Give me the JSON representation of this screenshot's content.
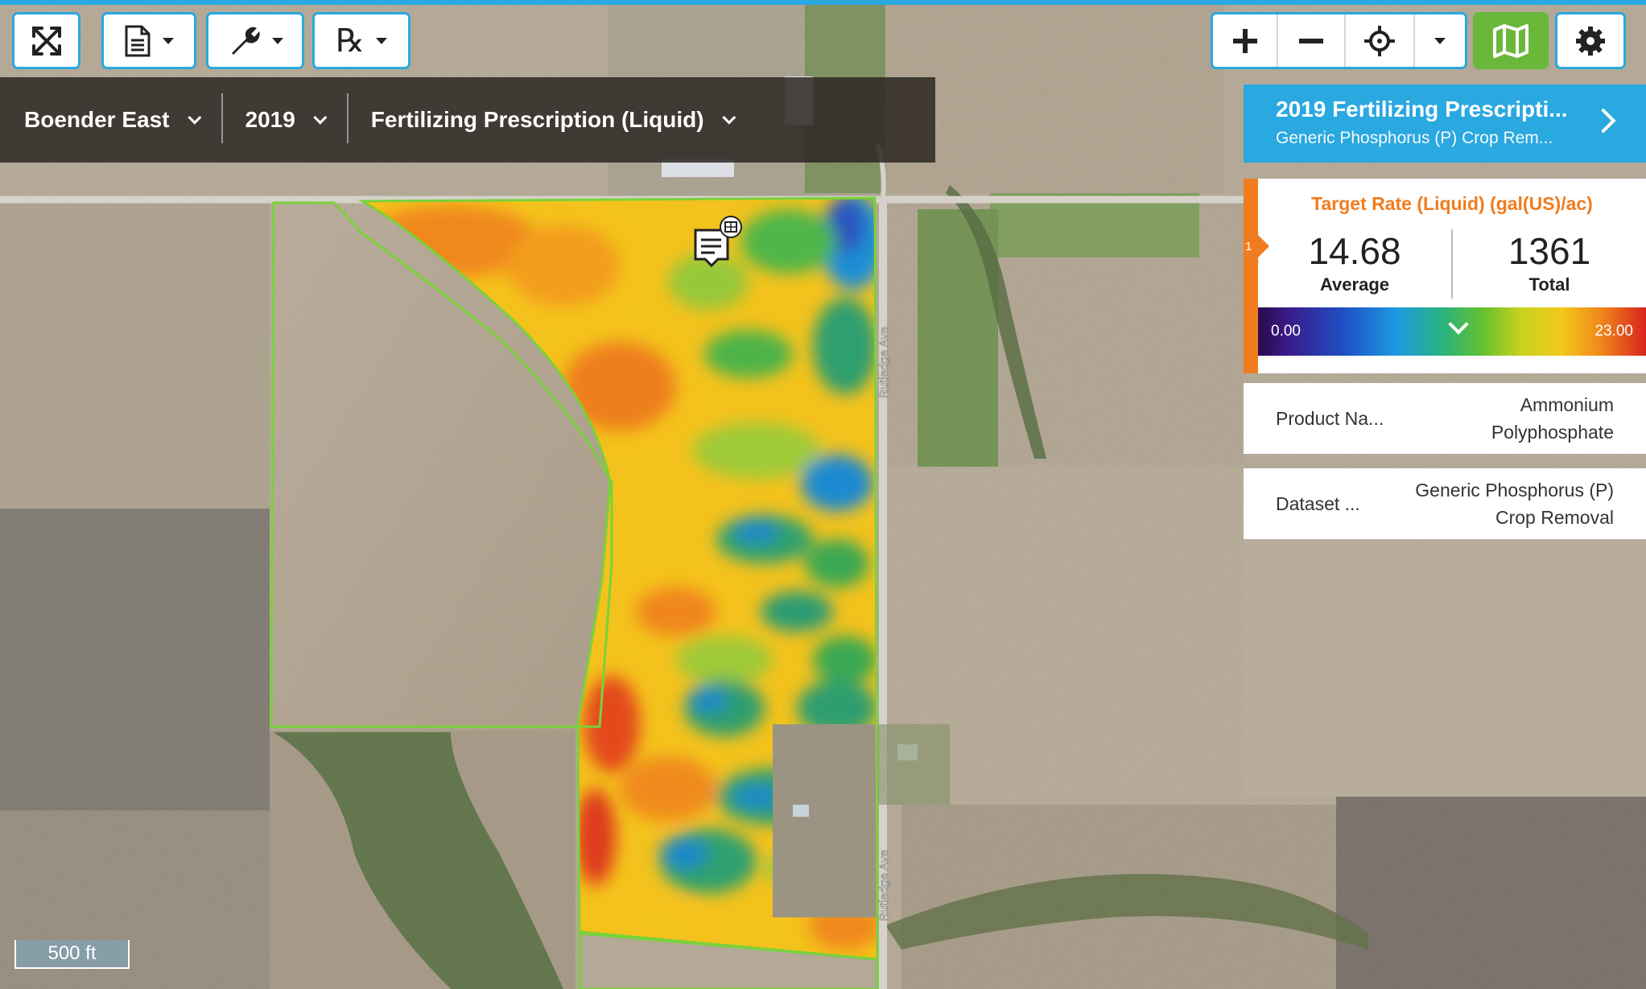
{
  "toolbar": {
    "left": [
      {
        "id": "fullscreen",
        "icon": "fullscreen-icon"
      },
      {
        "id": "reports",
        "icon": "document-icon",
        "dropdown": true
      },
      {
        "id": "tools",
        "icon": "wrench-icon",
        "dropdown": true
      },
      {
        "id": "prescription",
        "icon": "rx-icon",
        "glyph": "℞",
        "dropdown": true
      }
    ],
    "right": [
      {
        "id": "zoom-in",
        "icon": "plus-icon"
      },
      {
        "id": "zoom-out",
        "icon": "minus-icon"
      },
      {
        "id": "locate",
        "icon": "crosshair-icon"
      },
      {
        "id": "locate-menu",
        "icon": "caret-down-icon"
      },
      {
        "id": "layers",
        "icon": "map-icon",
        "active_color": "#6ab83a"
      },
      {
        "id": "settings",
        "icon": "gear-icon"
      }
    ]
  },
  "selectors": {
    "field": "Boender East",
    "year": "2019",
    "layer": "Fertilizing Prescription (Liquid)"
  },
  "panel": {
    "title": "2019 Fertilizing Prescripti...",
    "subtitle": "Generic Phosphorus (P) Crop Rem...",
    "tab_index": "1",
    "stats_title": "Target Rate (Liquid) (gal(US)/ac)",
    "average_value": "14.68",
    "average_label": "Average",
    "total_value": "1361",
    "total_label": "Total",
    "ramp_min": "0.00",
    "ramp_max": "23.00",
    "product_label": "Product Na...",
    "product_value_line1": "Ammonium",
    "product_value_line2": "Polyphosphate",
    "dataset_label": "Dataset ...",
    "dataset_value_line1": "Generic Phosphorus (P)",
    "dataset_value_line2": "Crop Removal"
  },
  "map": {
    "road_label_upper": "Rutledge Ave",
    "road_label_lower": "Rutledge Ave",
    "scale_label": "500 ft"
  },
  "colors": {
    "accent": "#2aa8e0",
    "orange": "#f07c1f",
    "active_green": "#6ab83a"
  }
}
